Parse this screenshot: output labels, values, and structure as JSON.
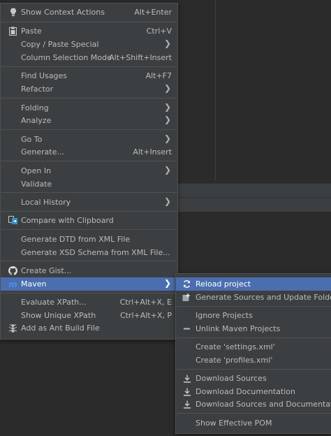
{
  "main_menu": {
    "show_context_actions": {
      "label": "Show Context Actions",
      "shortcut": "Alt+Enter"
    },
    "paste": {
      "label": "Paste",
      "shortcut": "Ctrl+V"
    },
    "copy_paste_special": {
      "label": "Copy / Paste Special"
    },
    "column_selection_mode": {
      "label": "Column Selection Mode",
      "shortcut": "Alt+Shift+Insert"
    },
    "find_usages": {
      "label": "Find Usages",
      "shortcut": "Alt+F7"
    },
    "refactor": {
      "label": "Refactor"
    },
    "folding": {
      "label": "Folding"
    },
    "analyze": {
      "label": "Analyze"
    },
    "go_to": {
      "label": "Go To"
    },
    "generate": {
      "label": "Generate...",
      "shortcut": "Alt+Insert"
    },
    "open_in": {
      "label": "Open In"
    },
    "validate": {
      "label": "Validate"
    },
    "local_history": {
      "label": "Local History"
    },
    "compare_with_clipboard": {
      "label": "Compare with Clipboard"
    },
    "generate_dtd": {
      "label": "Generate DTD from XML File"
    },
    "generate_xsd": {
      "label": "Generate XSD Schema from XML File..."
    },
    "create_gist": {
      "label": "Create Gist..."
    },
    "maven": {
      "label": "Maven"
    },
    "evaluate_xpath": {
      "label": "Evaluate XPath...",
      "shortcut": "Ctrl+Alt+X, E"
    },
    "show_unique_xpath": {
      "label": "Show Unique XPath",
      "shortcut": "Ctrl+Alt+X, P"
    },
    "add_as_ant_build_file": {
      "label": "Add as Ant Build File"
    }
  },
  "maven_submenu": {
    "reload_project": {
      "label": "Reload project"
    },
    "generate_sources": {
      "label": "Generate Sources and Update Folders"
    },
    "ignore_projects": {
      "label": "Ignore Projects"
    },
    "unlink_maven_projects": {
      "label": "Unlink Maven Projects"
    },
    "create_settings_xml": {
      "label": "Create 'settings.xml'"
    },
    "create_profiles_xml": {
      "label": "Create 'profiles.xml'"
    },
    "download_sources": {
      "label": "Download Sources"
    },
    "download_documentation": {
      "label": "Download Documentation"
    },
    "download_sources_and_documentation": {
      "label": "Download Sources and Documentation"
    },
    "show_effective_pom": {
      "label": "Show Effective POM"
    }
  },
  "colors": {
    "menu_bg": "#3c3f41",
    "highlight": "#4b6eaf",
    "text": "#bbbbbb",
    "separator": "#515151",
    "maven_icon": "#4a8fe7",
    "compare_icon": "#3592c4"
  },
  "icons": {
    "show_context_actions": "lightbulb-icon",
    "paste": "clipboard-icon",
    "compare_with_clipboard": "compare-icon",
    "create_gist": "github-icon",
    "maven": "maven-icon",
    "add_as_ant_build_file": "ant-icon",
    "reload_project": "reload-icon",
    "generate_sources": "generate-sources-icon",
    "unlink_maven_projects": "minus-icon",
    "download": "download-icon"
  }
}
